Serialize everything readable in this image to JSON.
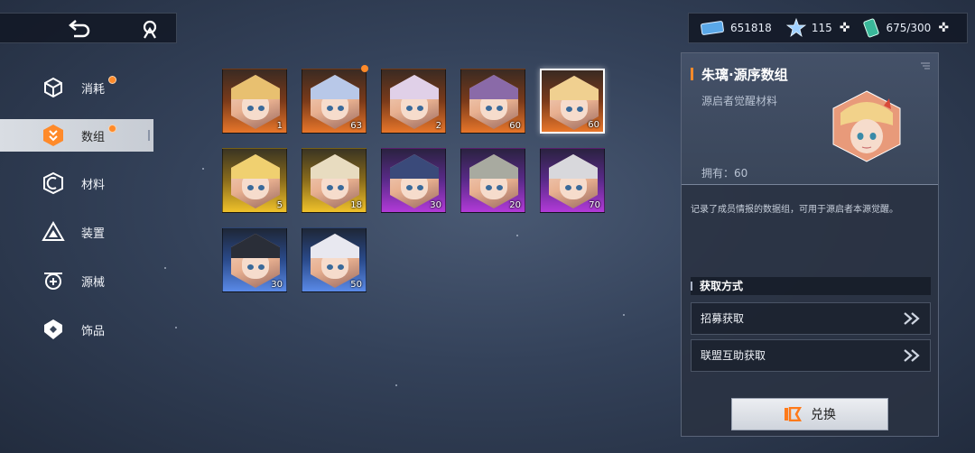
{
  "topbar": {
    "back_icon": "back-arrow-icon",
    "home_icon": "home-icon"
  },
  "currencies": [
    {
      "icon": "ticket-icon",
      "value": "651818",
      "plus": false
    },
    {
      "icon": "star-crystal-icon",
      "value": "115",
      "plus": true
    },
    {
      "icon": "energy-battery-icon",
      "value": "675/300",
      "plus": true
    }
  ],
  "sidebar": {
    "items": [
      {
        "label": "消耗",
        "icon": "cube-icon",
        "dot": true,
        "active": false
      },
      {
        "label": "数组",
        "icon": "data-array-icon",
        "dot": true,
        "active": true
      },
      {
        "label": "材料",
        "icon": "material-icon",
        "dot": false,
        "active": false
      },
      {
        "label": "装置",
        "icon": "device-icon",
        "dot": false,
        "active": false
      },
      {
        "label": "源械",
        "icon": "mecha-icon",
        "dot": false,
        "active": false
      },
      {
        "label": "饰品",
        "icon": "accessory-icon",
        "dot": false,
        "active": false
      }
    ]
  },
  "grid": {
    "cards": [
      {
        "count": "1",
        "rarity": "orange",
        "hair": "#e8c070"
      },
      {
        "count": "63",
        "rarity": "orange",
        "hair": "#b8c8e8",
        "dot": true
      },
      {
        "count": "2",
        "rarity": "orange",
        "hair": "#e0d0e8"
      },
      {
        "count": "60",
        "rarity": "orange",
        "hair": "#8a6aa8"
      },
      {
        "count": "60",
        "rarity": "orange",
        "hair": "#f0d090",
        "selected": true
      },
      {
        "count": "5",
        "rarity": "yellow",
        "hair": "#f0d070"
      },
      {
        "count": "18",
        "rarity": "yellow",
        "hair": "#e8dcc0"
      },
      {
        "count": "30",
        "rarity": "purple",
        "hair": "#3a4a7a"
      },
      {
        "count": "20",
        "rarity": "purple",
        "hair": "#a8aaa0"
      },
      {
        "count": "70",
        "rarity": "purple",
        "hair": "#d8d8dc"
      },
      {
        "count": "30",
        "rarity": "blue",
        "hair": "#2a2e38"
      },
      {
        "count": "50",
        "rarity": "blue",
        "hair": "#e8e8f0"
      }
    ]
  },
  "panel": {
    "title": "朱璃·源序数组",
    "subtitle": "源启者觉醒材料",
    "owned": "拥有：60",
    "description": "记录了成员情报的数据组，可用于源启者本源觉醒。",
    "source_header": "获取方式",
    "sources": [
      "招募获取",
      "联盟互助获取"
    ],
    "redeem_label": "兑换"
  },
  "colors": {
    "accent": "#ff8a2a",
    "panel_bg": "#2a3242"
  }
}
